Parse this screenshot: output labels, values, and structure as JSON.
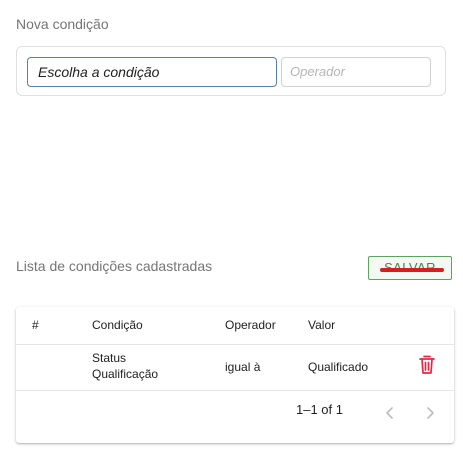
{
  "new_condition": {
    "title": "Nova condição",
    "condition_select_value": "Escolha a condição",
    "operator_placeholder": "Operador"
  },
  "list": {
    "title": "Lista de condições cadastradas",
    "save_label": "SALVAR",
    "columns": [
      "#",
      "Condição",
      "Operador",
      "Valor"
    ],
    "rows": [
      {
        "index": "",
        "condition_line1": "Status",
        "condition_line2": "Qualificação",
        "operator": "igual à",
        "value": "Qualificado"
      }
    ],
    "pagination": {
      "range_text": "1–1 of 1"
    }
  },
  "colors": {
    "save_border": "#5aa45d",
    "save_text": "#3c8a40",
    "save_underline": "#d1201e",
    "delete_icon": "#e0284a",
    "select_border": "#5c7fa8"
  },
  "icons": {
    "delete": "trash-icon",
    "prev_page": "chevron-left-icon",
    "next_page": "chevron-right-icon"
  }
}
